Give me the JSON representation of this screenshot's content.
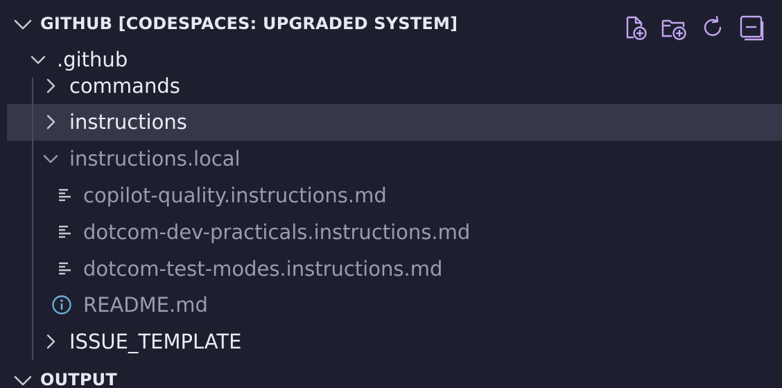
{
  "explorer": {
    "section_title": "GITHUB [CODESPACES: UPGRADED SYSTEM]",
    "actions": [
      {
        "name": "new-file-icon"
      },
      {
        "name": "new-folder-icon"
      },
      {
        "name": "refresh-icon"
      },
      {
        "name": "collapse-all-icon"
      }
    ],
    "tree": {
      "root": ".github",
      "commands": "commands",
      "instructions": "instructions",
      "instructions_local": "instructions.local",
      "file1": "copilot-quality.instructions.md",
      "file2": "dotcom-dev-practicals.instructions.md",
      "file3": "dotcom-test-modes.instructions.md",
      "readme": "README.md",
      "issue_template": "ISSUE_TEMPLATE"
    },
    "output_title": "OUTPUT"
  },
  "colors": {
    "background": "#1e1f2e",
    "selected_row": "#363849",
    "accent_icon": "#c4a7f5",
    "info_icon": "#6aaed6",
    "text_bright": "#ececf5",
    "text_dim": "#9a9bad"
  }
}
